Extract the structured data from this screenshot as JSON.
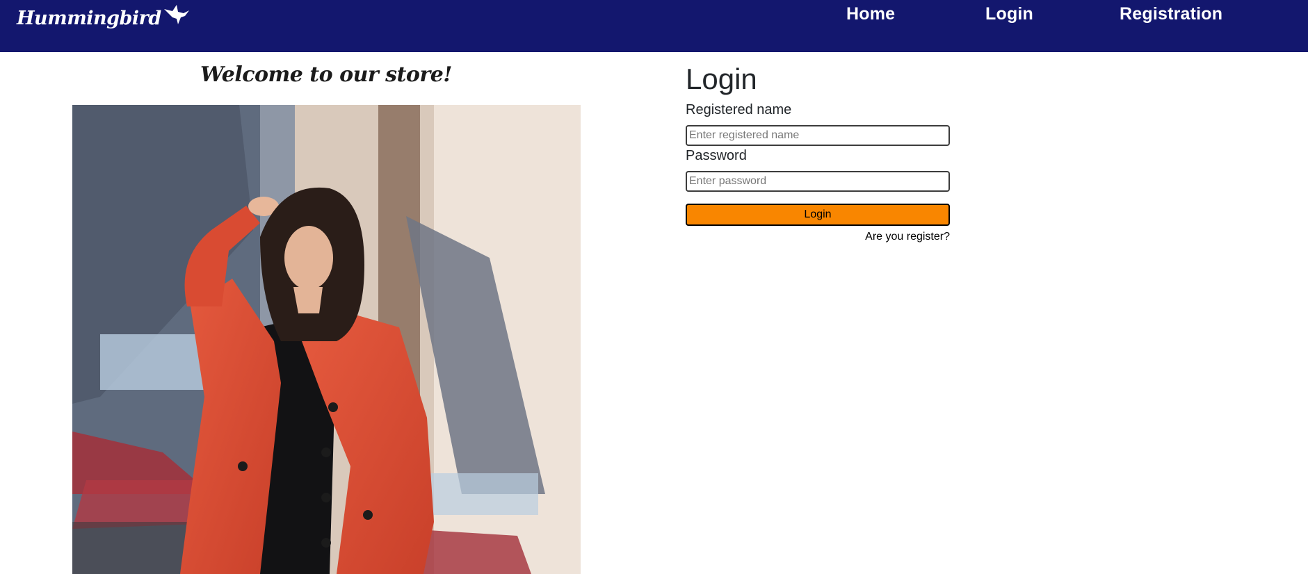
{
  "navbar": {
    "brand": "Hummingbird",
    "brand_icon": "hummingbird-icon",
    "links": {
      "home": "Home",
      "login": "Login",
      "registration": "Registration"
    },
    "background": "#13176e"
  },
  "main": {
    "welcome": "Welcome to our store!"
  },
  "login": {
    "title": "Login",
    "name_label": "Registered name",
    "name_placeholder": "Enter registered name",
    "name_value": "",
    "password_label": "Password",
    "password_placeholder": "Enter password",
    "password_value": "",
    "submit_label": "Login",
    "submit_color": "#f98600",
    "register_link": "Are you register?"
  }
}
